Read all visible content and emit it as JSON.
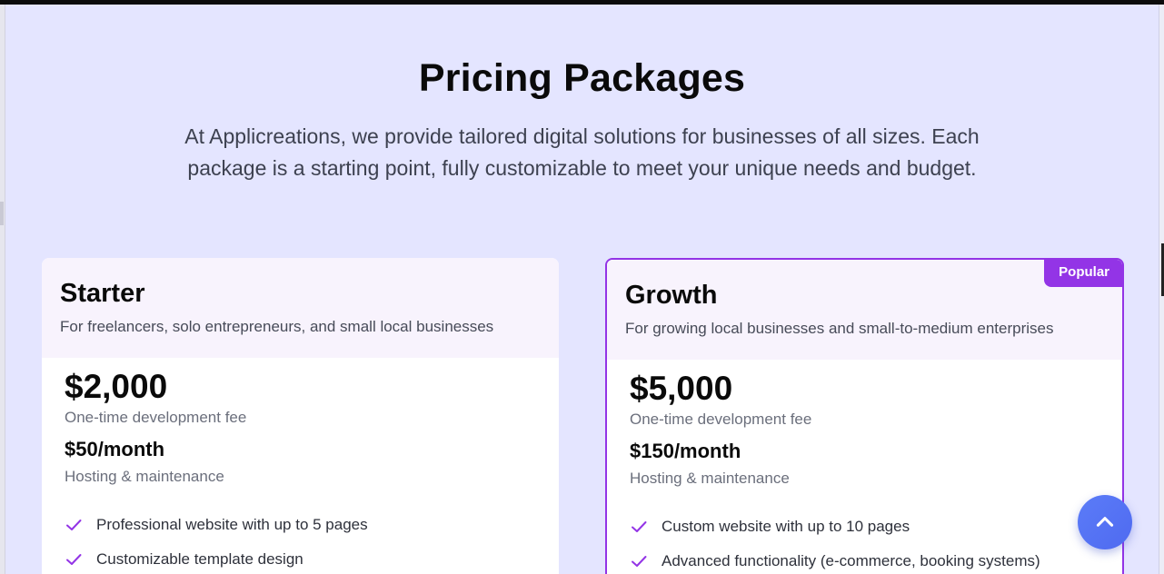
{
  "section": {
    "title": "Pricing Packages",
    "subtitle": "At Applicreations, we provide tailored digital solutions for businesses of all sizes. Each package is a starting point, fully customizable to meet your unique needs and budget."
  },
  "packages": [
    {
      "name": "Starter",
      "description": "For freelancers, solo entrepreneurs, and small local businesses",
      "price": "$2,000",
      "price_note": "One-time development fee",
      "monthly": "$50/month",
      "monthly_note": "Hosting & maintenance",
      "features": [
        "Professional website with up to 5 pages",
        "Customizable template design"
      ]
    },
    {
      "name": "Growth",
      "badge": "Popular",
      "description": "For growing local businesses and small-to-medium enterprises",
      "price": "$5,000",
      "price_note": "One-time development fee",
      "monthly": "$150/month",
      "monthly_note": "Hosting & maintenance",
      "features": [
        "Custom website with up to 10 pages",
        "Advanced functionality (e-commerce, booking systems)"
      ]
    }
  ],
  "icons": {
    "feature_check": "check-icon",
    "scroll_top": "chevron-up-icon"
  },
  "colors": {
    "background": "#e4e5ff",
    "accent": "#9334e6",
    "card_header": "#f8f3fd",
    "scroll_button": "#5572f4"
  }
}
